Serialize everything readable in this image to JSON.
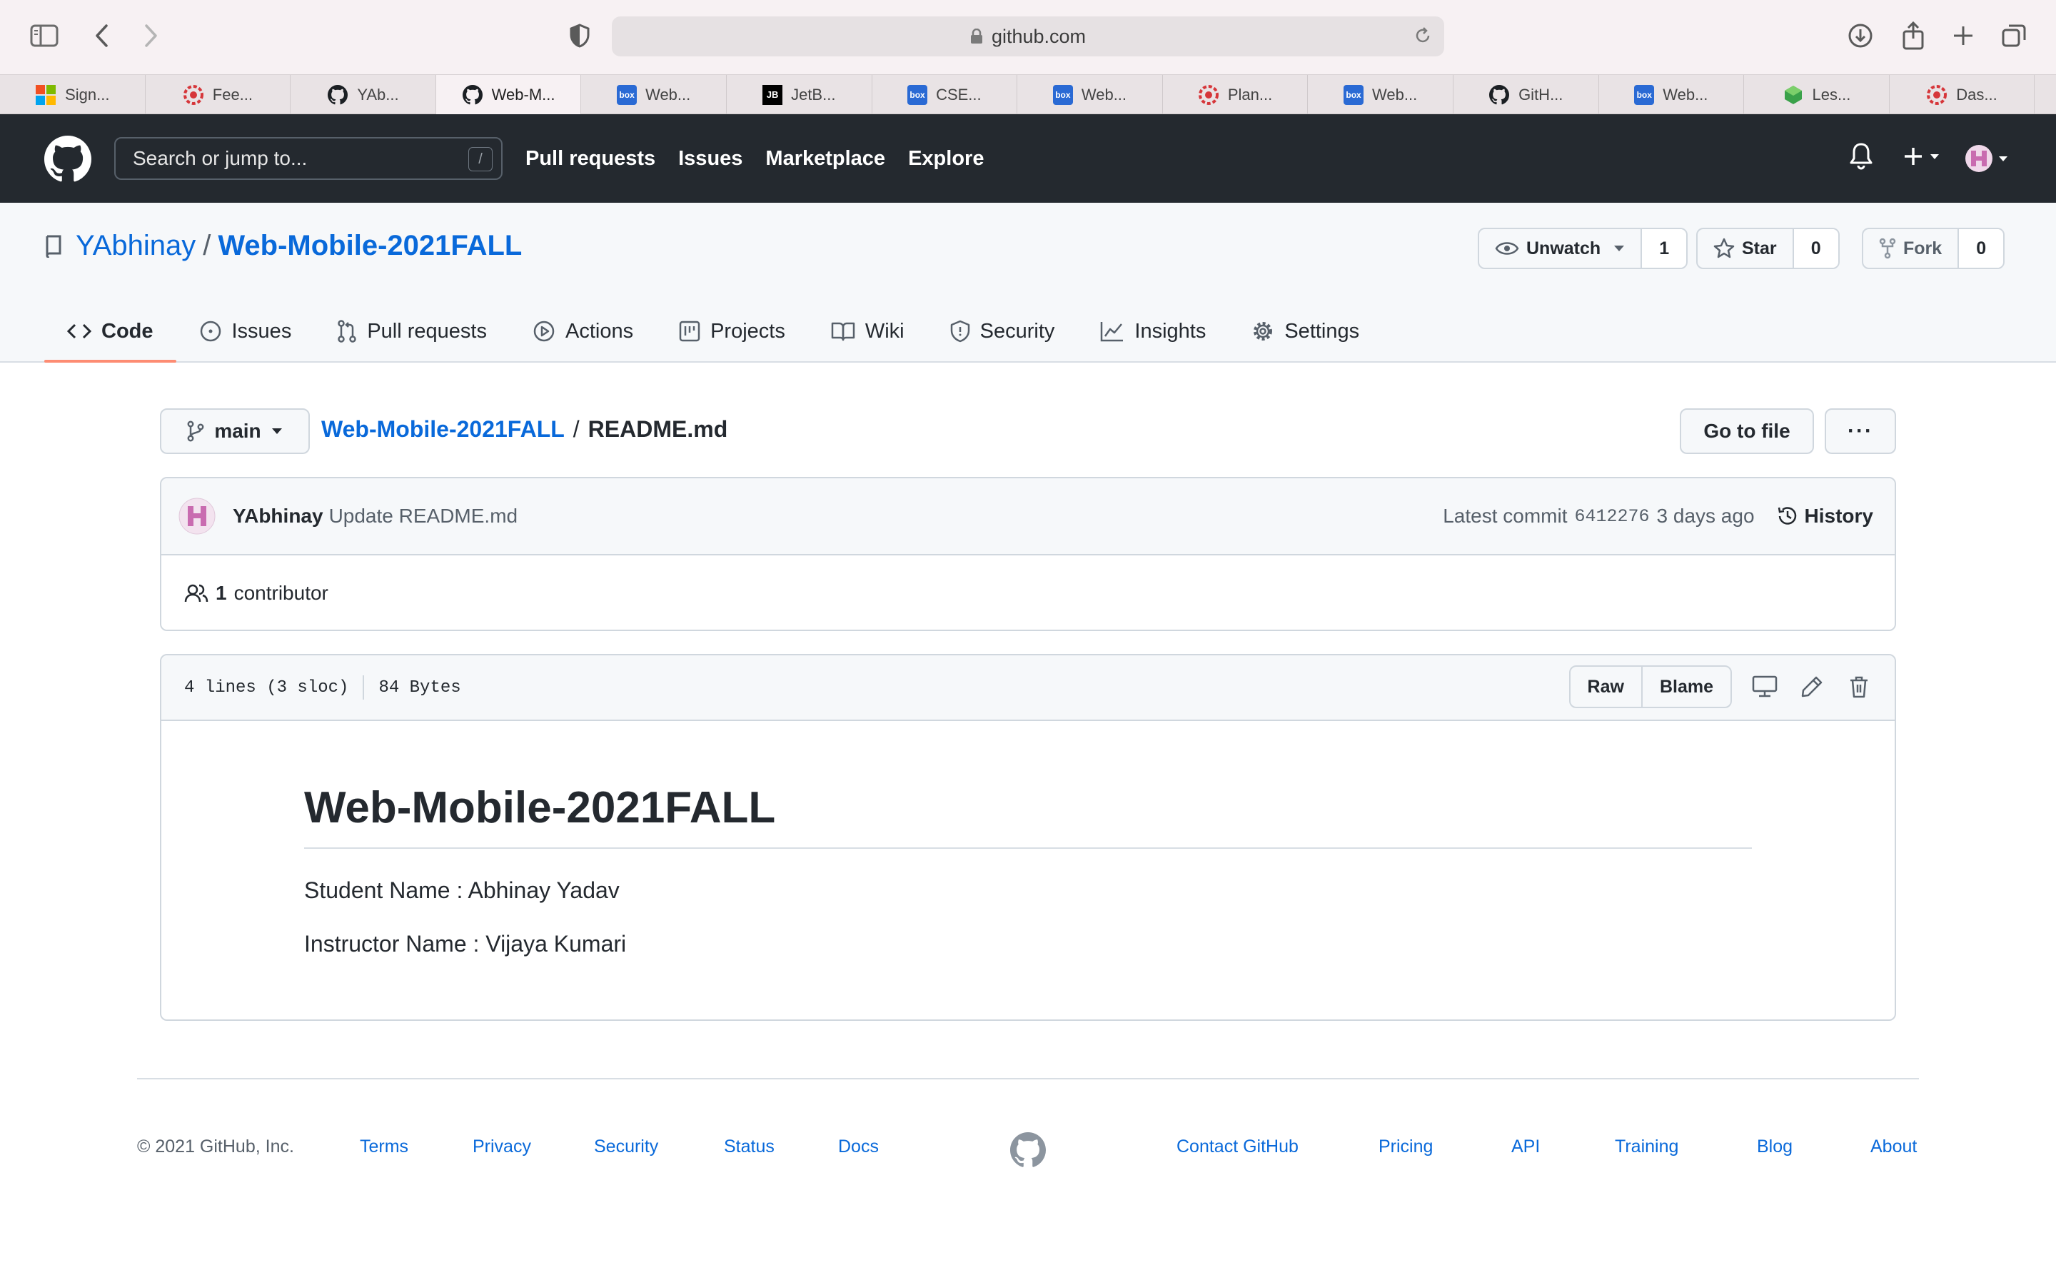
{
  "browser": {
    "url": "github.com",
    "tabs": [
      {
        "label": "Sign...",
        "icon": "microsoft-icon"
      },
      {
        "label": "Fee...",
        "icon": "red-gear-icon"
      },
      {
        "label": "YAb...",
        "icon": "github-icon"
      },
      {
        "label": "Web-M...",
        "icon": "github-icon",
        "active": true
      },
      {
        "label": "Web...",
        "icon": "box-icon"
      },
      {
        "label": "JetB...",
        "icon": "jetbrains-icon"
      },
      {
        "label": "CSE...",
        "icon": "box-icon"
      },
      {
        "label": "Web...",
        "icon": "box-icon"
      },
      {
        "label": "Plan...",
        "icon": "red-gear-icon"
      },
      {
        "label": "Web...",
        "icon": "box-icon"
      },
      {
        "label": "GitH...",
        "icon": "github-icon"
      },
      {
        "label": "Web...",
        "icon": "box-icon"
      },
      {
        "label": "Les...",
        "icon": "green-cube-icon"
      },
      {
        "label": "Das...",
        "icon": "red-gear-icon"
      }
    ]
  },
  "header": {
    "search_placeholder": "Search or jump to...",
    "search_shortcut": "/",
    "nav": [
      "Pull requests",
      "Issues",
      "Marketplace",
      "Explore"
    ]
  },
  "repo": {
    "owner": "YAbhinay",
    "separator": "/",
    "name": "Web-Mobile-2021FALL",
    "watch_label": "Unwatch",
    "watch_count": "1",
    "star_label": "Star",
    "star_count": "0",
    "fork_label": "Fork",
    "fork_count": "0",
    "tabs": [
      "Code",
      "Issues",
      "Pull requests",
      "Actions",
      "Projects",
      "Wiki",
      "Security",
      "Insights",
      "Settings"
    ]
  },
  "file": {
    "branch": "main",
    "breadcrumb_repo": "Web-Mobile-2021FALL",
    "breadcrumb_sep": "/",
    "breadcrumb_file": "README.md",
    "goto_label": "Go to file",
    "more_label": "···",
    "commit_author": "YAbhinay",
    "commit_message": "Update README.md",
    "latest_commit_label": "Latest commit",
    "commit_sha": "6412276",
    "commit_age": "3 days ago",
    "history_label": "History",
    "contributor_count": "1",
    "contributor_label": "contributor",
    "lines_info": "4 lines (3 sloc)",
    "size_info": "84 Bytes",
    "raw_label": "Raw",
    "blame_label": "Blame"
  },
  "readme": {
    "heading": "Web-Mobile-2021FALL",
    "student_line": "Student Name : Abhinay Yadav",
    "instructor_line": "Instructor Name : Vijaya Kumari"
  },
  "footer": {
    "copyright": "© 2021 GitHub, Inc.",
    "links_left": [
      "Terms",
      "Privacy",
      "Security",
      "Status",
      "Docs"
    ],
    "links_right": [
      "Contact GitHub",
      "Pricing",
      "API",
      "Training",
      "Blog",
      "About"
    ]
  },
  "colors": {
    "header_bg": "#24292f",
    "link": "#0969da",
    "tab_underline": "#fd8c73",
    "border": "#d0d7de"
  }
}
